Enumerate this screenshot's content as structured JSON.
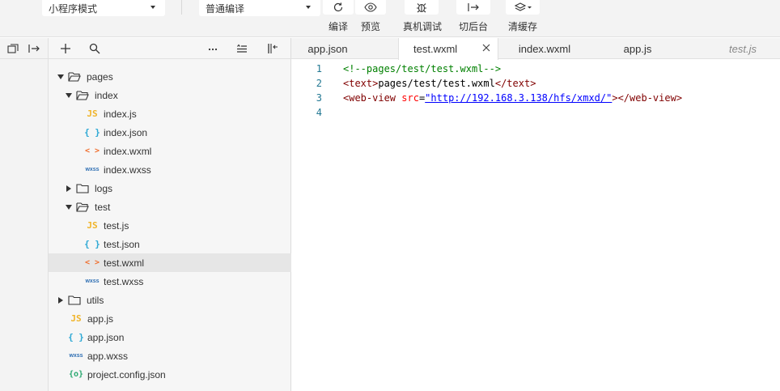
{
  "toolbar": {
    "mode_select": "小程序模式",
    "compile_select": "普通编译",
    "buttons": [
      {
        "label": "编译",
        "icon": "refresh-icon"
      },
      {
        "label": "预览",
        "icon": "eye-icon"
      },
      {
        "label": "真机调试",
        "icon": "bug-icon"
      },
      {
        "label": "切后台",
        "icon": "switch-background-icon"
      },
      {
        "label": "清缓存",
        "icon": "layers-icon"
      }
    ]
  },
  "tree": {
    "items": [
      {
        "label": "pages",
        "type": "folder",
        "state": "open",
        "depth": 0
      },
      {
        "label": "index",
        "type": "folder",
        "state": "open",
        "depth": 1
      },
      {
        "label": "index.js",
        "type": "js",
        "icon_text": "JS",
        "depth": 2
      },
      {
        "label": "index.json",
        "type": "json",
        "icon_text": "{ }",
        "depth": 2
      },
      {
        "label": "index.wxml",
        "type": "wxml",
        "icon_text": "< >",
        "depth": 2
      },
      {
        "label": "index.wxss",
        "type": "wxss",
        "icon_text": "wxss",
        "depth": 2
      },
      {
        "label": "logs",
        "type": "folder",
        "state": "closed",
        "depth": 1
      },
      {
        "label": "test",
        "type": "folder",
        "state": "open",
        "depth": 1
      },
      {
        "label": "test.js",
        "type": "js",
        "icon_text": "JS",
        "depth": 2
      },
      {
        "label": "test.json",
        "type": "json",
        "icon_text": "{ }",
        "depth": 2
      },
      {
        "label": "test.wxml",
        "type": "wxml",
        "icon_text": "< >",
        "depth": 2,
        "selected": true
      },
      {
        "label": "test.wxss",
        "type": "wxss",
        "icon_text": "wxss",
        "depth": 2
      },
      {
        "label": "utils",
        "type": "folder",
        "state": "closed",
        "depth": 0
      },
      {
        "label": "app.js",
        "type": "js",
        "icon_text": "JS",
        "depth": 0
      },
      {
        "label": "app.json",
        "type": "json",
        "icon_text": "{ }",
        "depth": 0
      },
      {
        "label": "app.wxss",
        "type": "wxss",
        "icon_text": "wxss",
        "depth": 0
      },
      {
        "label": "project.config.json",
        "type": "config",
        "icon_text": "{o}",
        "depth": 0
      }
    ]
  },
  "editor": {
    "tabs": [
      {
        "label": "app.json"
      },
      {
        "label": "test.wxml",
        "active": true
      },
      {
        "label": "index.wxml"
      },
      {
        "label": "app.js"
      },
      {
        "label": "test.js",
        "preview": true
      }
    ],
    "lines": [
      {
        "num": "1",
        "tokens": [
          {
            "t": "<!--pages/test/test.wxml-->",
            "c": "comment"
          }
        ]
      },
      {
        "num": "2",
        "tokens": [
          {
            "t": "<text>",
            "c": "tag"
          },
          {
            "t": "pages/test/test.wxml",
            "c": "text"
          },
          {
            "t": "</text>",
            "c": "tag"
          }
        ]
      },
      {
        "num": "3",
        "tokens": [
          {
            "t": "<web-view ",
            "c": "tag"
          },
          {
            "t": "src",
            "c": "attr"
          },
          {
            "t": "=",
            "c": "text"
          },
          {
            "t": "\"http://192.168.3.138/hfs/xmxd/\"",
            "c": "str"
          },
          {
            "t": "></web-view>",
            "c": "tag"
          }
        ]
      },
      {
        "num": "4",
        "tokens": []
      }
    ]
  },
  "colors": {
    "js": "#f0b429",
    "json": "#2aa7d4",
    "wxml": "#f07030",
    "wxss": "#2f6fb3",
    "config": "#2aa870"
  }
}
